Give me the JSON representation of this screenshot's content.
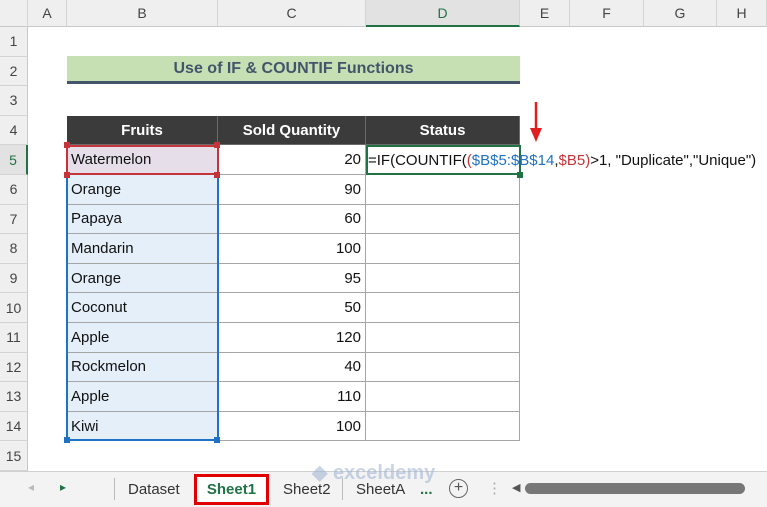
{
  "columns": [
    "A",
    "B",
    "C",
    "D",
    "E",
    "F",
    "G",
    "H"
  ],
  "rows": [
    "1",
    "2",
    "3",
    "4",
    "5",
    "6",
    "7",
    "8",
    "9",
    "10",
    "11",
    "12",
    "13",
    "14",
    "15"
  ],
  "title": "Use of IF & COUNTIF Functions",
  "table": {
    "headers": [
      "Fruits",
      "Sold Quantity",
      "Status"
    ],
    "rows": [
      {
        "fruit": "Watermelon",
        "qty": "20"
      },
      {
        "fruit": "Orange",
        "qty": "90"
      },
      {
        "fruit": "Papaya",
        "qty": "60"
      },
      {
        "fruit": "Mandarin",
        "qty": "100"
      },
      {
        "fruit": "Orange",
        "qty": "95"
      },
      {
        "fruit": "Coconut",
        "qty": "50"
      },
      {
        "fruit": "Apple",
        "qty": "120"
      },
      {
        "fruit": "Rockmelon",
        "qty": "40"
      },
      {
        "fruit": "Apple",
        "qty": "110"
      },
      {
        "fruit": "Kiwi",
        "qty": "100"
      }
    ]
  },
  "formula": {
    "p1": "=IF(COUNTIF(",
    "p2": "$B$5:$B$14",
    "p3": ",",
    "p4": "$B5",
    "p5": ")",
    "p6": ">1, \"Duplicate\",\"Unique\")"
  },
  "colors": {
    "range_blue": "#1f72c4",
    "ref_red": "#c4343a",
    "active_green": "#217346",
    "annotation_red": "#e02020"
  },
  "sheets": [
    "Dataset",
    "Sheet1",
    "Sheet2",
    "SheetA"
  ],
  "active_sheet": "Sheet1",
  "more_tabs": "...",
  "watermark": "exceldemy EXCEL · DATA · BI"
}
